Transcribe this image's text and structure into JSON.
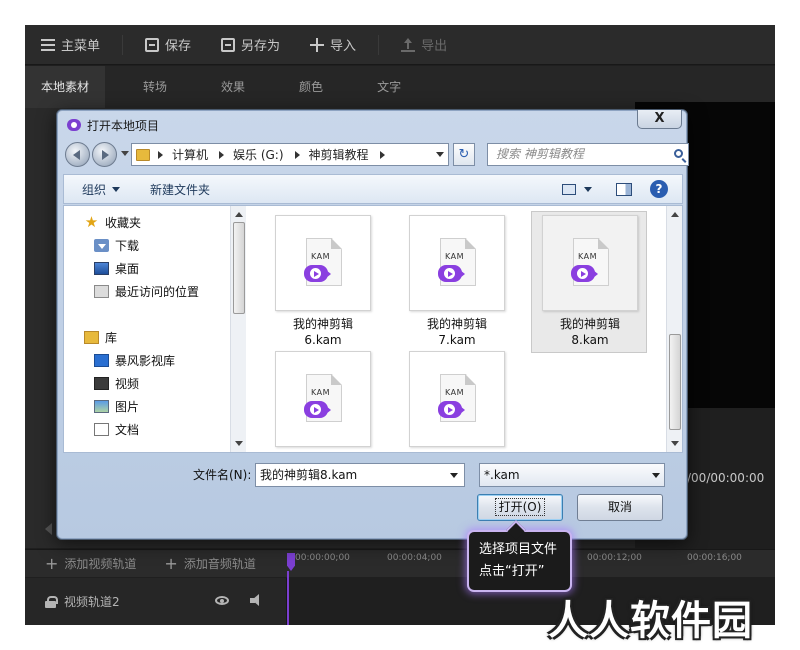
{
  "toolbar": {
    "main_menu": "主菜单",
    "save": "保存",
    "save_as": "另存为",
    "import": "导入",
    "export": "导出"
  },
  "tabs": [
    {
      "label": "本地素材",
      "active": true
    },
    {
      "label": "转场"
    },
    {
      "label": "效果"
    },
    {
      "label": "颜色"
    },
    {
      "label": "文字"
    }
  ],
  "player": {
    "time": "/00/00:00:00"
  },
  "timeline": {
    "add_video_track": "添加视频轨道",
    "add_audio_track": "添加音频轨道",
    "ticks": [
      "00:00:00;00",
      "00:00:04;00",
      "00:00:12;00",
      "00:00:16;00"
    ],
    "track_name": "视频轨道2"
  },
  "dialog": {
    "title": "打开本地项目",
    "close_label": "X",
    "breadcrumbs": [
      "计算机",
      "娱乐 (G:)",
      "神剪辑教程"
    ],
    "search_placeholder": "搜索 神剪辑教程",
    "organize": "组织",
    "new_folder": "新建文件夹",
    "help": "?",
    "nav_tree": {
      "favorites": "收藏夹",
      "downloads": "下载",
      "desktop": "桌面",
      "recent": "最近访问的位置",
      "libraries": "库",
      "baofeng": "暴风影视库",
      "videos": "视频",
      "pictures": "图片",
      "documents": "文档"
    },
    "files": [
      {
        "line1": "我的神剪辑",
        "line2": "6.kam",
        "selected": false
      },
      {
        "line1": "我的神剪辑",
        "line2": "7.kam",
        "selected": false
      },
      {
        "line1": "我的神剪辑",
        "line2": "8.kam",
        "selected": true
      },
      {
        "line1": "",
        "line2": "",
        "selected": false
      },
      {
        "line1": "",
        "line2": "",
        "selected": false
      }
    ],
    "file_badge": "KAM",
    "filename_label": "文件名(N):",
    "filename_value": "我的神剪辑8.kam",
    "filetype_value": "*.kam",
    "open_button": "打开(O)",
    "cancel_button": "取消"
  },
  "tooltip": {
    "line1": "选择项目文件",
    "line2": "点击“打开”"
  },
  "watermark": "人人软件园",
  "colors": {
    "accent_purple": "#7b3fd0",
    "app_background": "#1f1f1f",
    "dialog_chrome": "#c9d7ea"
  }
}
